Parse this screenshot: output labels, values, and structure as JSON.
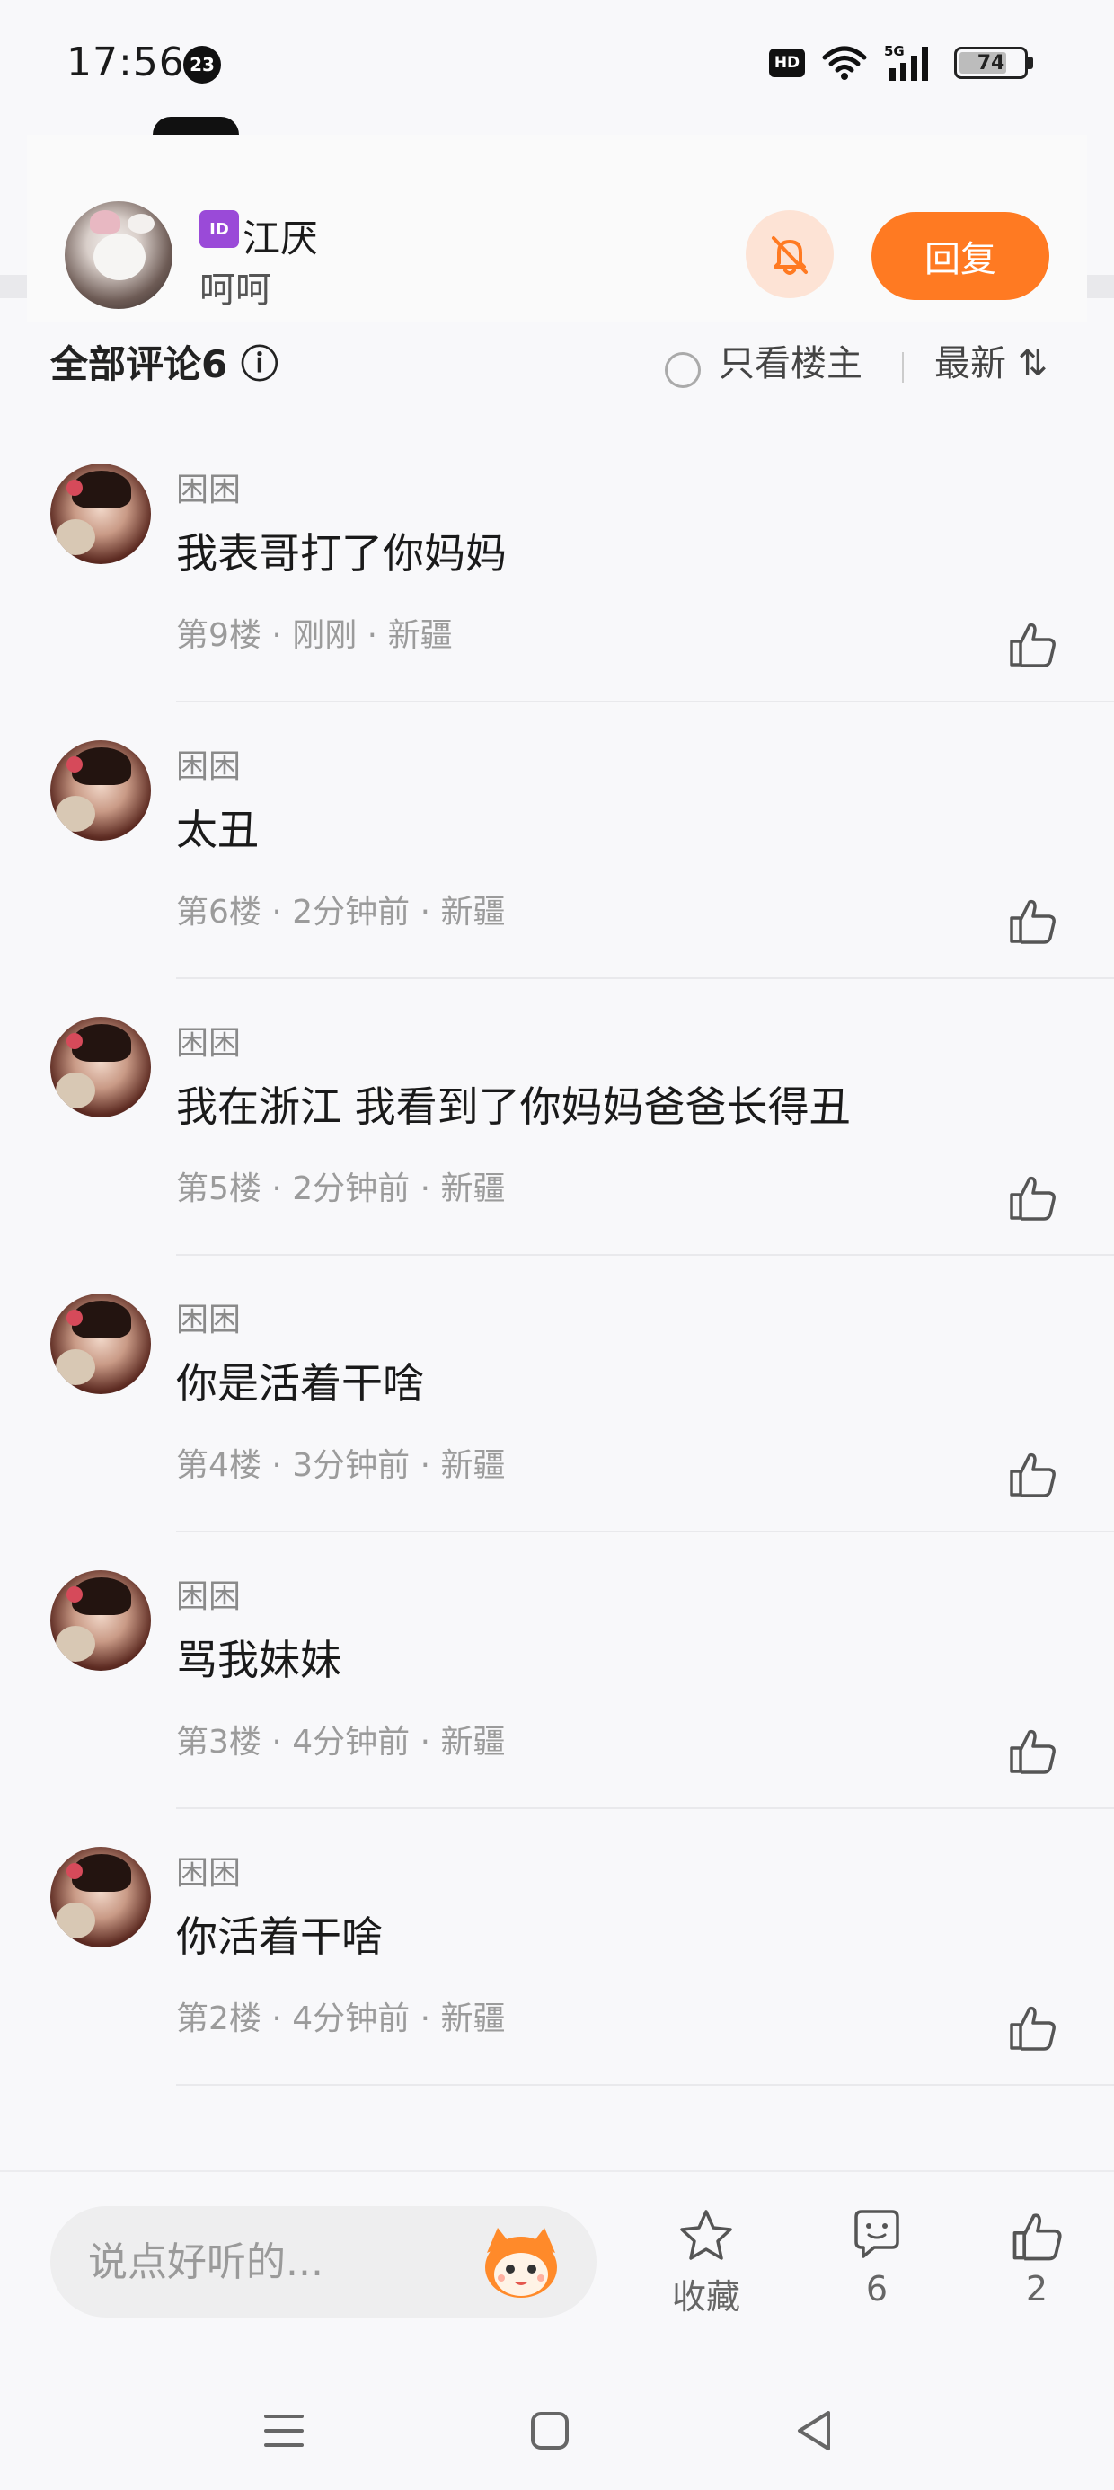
{
  "status_bar": {
    "time": "17:56",
    "notification_count": "23",
    "hd_label": "HD",
    "network": "5G",
    "battery": "74"
  },
  "header": {
    "id_badge": "ID",
    "name": "江厌",
    "subtitle": "呵呵",
    "reply_label": "回复"
  },
  "comments": [
    {
      "name": "困困",
      "text": "我表哥打了你妈妈",
      "meta": "第9楼 · 刚刚 · 新疆"
    },
    {
      "name": "困困",
      "text": "太丑",
      "meta": "第6楼 · 2分钟前 · 新疆"
    },
    {
      "name": "困困",
      "text": "我在浙江  我看到了你妈妈爸爸长得丑",
      "meta": "第5楼 · 2分钟前 · 新疆"
    },
    {
      "name": "困困",
      "text": "你是活着干啥",
      "meta": "第4楼 · 3分钟前 · 新疆"
    },
    {
      "name": "困困",
      "text": "骂我妹妹",
      "meta": "第3楼 · 4分钟前 · 新疆"
    },
    {
      "name": "困困",
      "text": "你活着干啥",
      "meta": "第2楼 · 4分钟前 · 新疆"
    }
  ],
  "bottom_bar": {
    "input_placeholder": "说点好听的...",
    "favorite_label": "收藏",
    "comment_count": "6",
    "like_count": "2"
  },
  "colors": {
    "accent": "#ff7a22",
    "mute_bg": "#fde3d5",
    "id_badge": "#9a4ad8"
  }
}
